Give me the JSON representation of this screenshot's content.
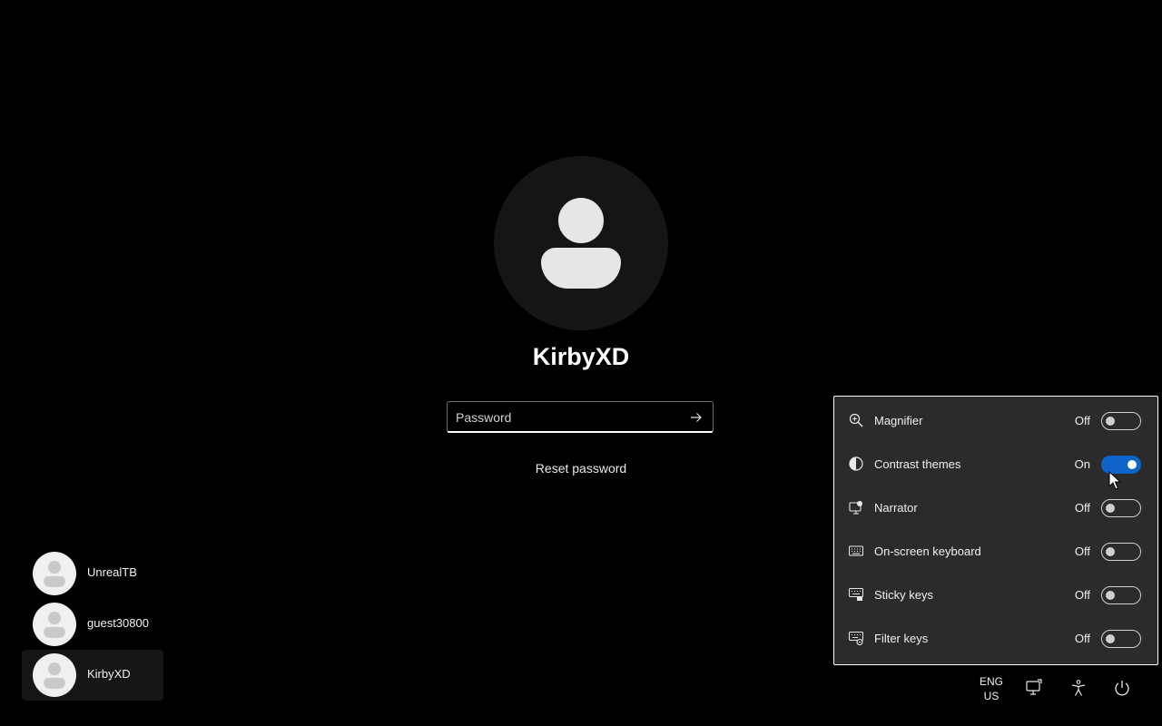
{
  "main_user": {
    "name": "KirbyXD",
    "password_placeholder": "Password",
    "reset_link": "Reset password"
  },
  "users": [
    {
      "name": "UnrealTB",
      "selected": false
    },
    {
      "name": "guest30800",
      "selected": false
    },
    {
      "name": "KirbyXD",
      "selected": true
    }
  ],
  "accessibility": {
    "items": [
      {
        "label": "Magnifier",
        "state": "Off",
        "on": false,
        "icon": "magnifier-icon"
      },
      {
        "label": "Contrast themes",
        "state": "On",
        "on": true,
        "icon": "contrast-icon"
      },
      {
        "label": "Narrator",
        "state": "Off",
        "on": false,
        "icon": "narrator-icon"
      },
      {
        "label": "On-screen keyboard",
        "state": "Off",
        "on": false,
        "icon": "keyboard-icon"
      },
      {
        "label": "Sticky keys",
        "state": "Off",
        "on": false,
        "icon": "sticky-keys-icon"
      },
      {
        "label": "Filter keys",
        "state": "Off",
        "on": false,
        "icon": "filter-keys-icon"
      }
    ]
  },
  "tray": {
    "lang_line1": "ENG",
    "lang_line2": "US"
  },
  "colors": {
    "background": "#000000",
    "flyout_bg": "#2b2b2b",
    "accent": "#0e63c8"
  }
}
